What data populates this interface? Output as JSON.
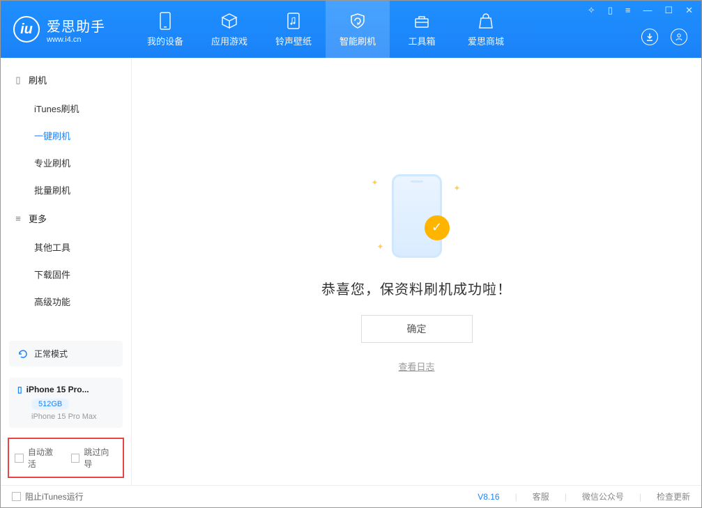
{
  "header": {
    "app_name": "爱思助手",
    "app_url": "www.i4.cn",
    "tabs": [
      {
        "label": "我的设备"
      },
      {
        "label": "应用游戏"
      },
      {
        "label": "铃声壁纸"
      },
      {
        "label": "智能刷机"
      },
      {
        "label": "工具箱"
      },
      {
        "label": "爱思商城"
      }
    ]
  },
  "sidebar": {
    "sections": [
      {
        "title": "刷机",
        "items": [
          "iTunes刷机",
          "一键刷机",
          "专业刷机",
          "批量刷机"
        ]
      },
      {
        "title": "更多",
        "items": [
          "其他工具",
          "下载固件",
          "高级功能"
        ]
      }
    ],
    "selected": "一键刷机",
    "status_mode": "正常模式",
    "device": {
      "name": "iPhone 15 Pro...",
      "storage": "512GB",
      "model": "iPhone 15 Pro Max"
    },
    "options": {
      "auto_activate": "自动激活",
      "skip_wizard": "跳过向导"
    }
  },
  "main": {
    "message": "恭喜您，保资料刷机成功啦！",
    "ok_label": "确定",
    "log_link": "查看日志"
  },
  "footer": {
    "block_itunes": "阻止iTunes运行",
    "version": "V8.16",
    "links": [
      "客服",
      "微信公众号",
      "检查更新"
    ]
  }
}
